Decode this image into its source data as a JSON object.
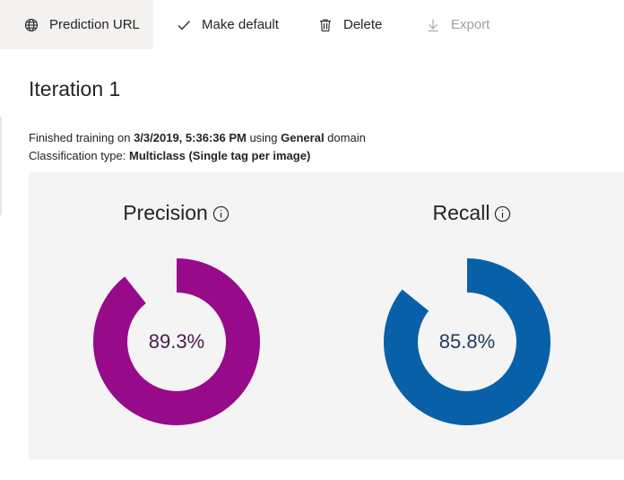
{
  "toolbar": {
    "prediction_url": "Prediction URL",
    "make_default": "Make default",
    "delete": "Delete",
    "export": "Export"
  },
  "page": {
    "title": "Iteration 1"
  },
  "meta": {
    "line1_prefix": "Finished training on ",
    "trained_at": "3/3/2019, 5:36:36 PM",
    "line1_mid": " using ",
    "domain": "General",
    "line1_suffix": " domain",
    "line2_prefix": "Classification type: ",
    "classification_type": "Multiclass (Single tag per image)"
  },
  "metrics": {
    "precision": {
      "label": "Precision",
      "value_text": "89.3%",
      "value": 0.893,
      "color": "#970a8a",
      "text_color": "#4b1a49"
    },
    "recall": {
      "label": "Recall",
      "value_text": "85.8%",
      "value": 0.858,
      "color": "#0861a8",
      "text_color": "#1f3b5c"
    }
  },
  "icons": {
    "prediction_url": "globe-icon",
    "make_default": "checkmark-icon",
    "delete": "trash-icon",
    "export": "download-icon",
    "info": "info-icon"
  }
}
